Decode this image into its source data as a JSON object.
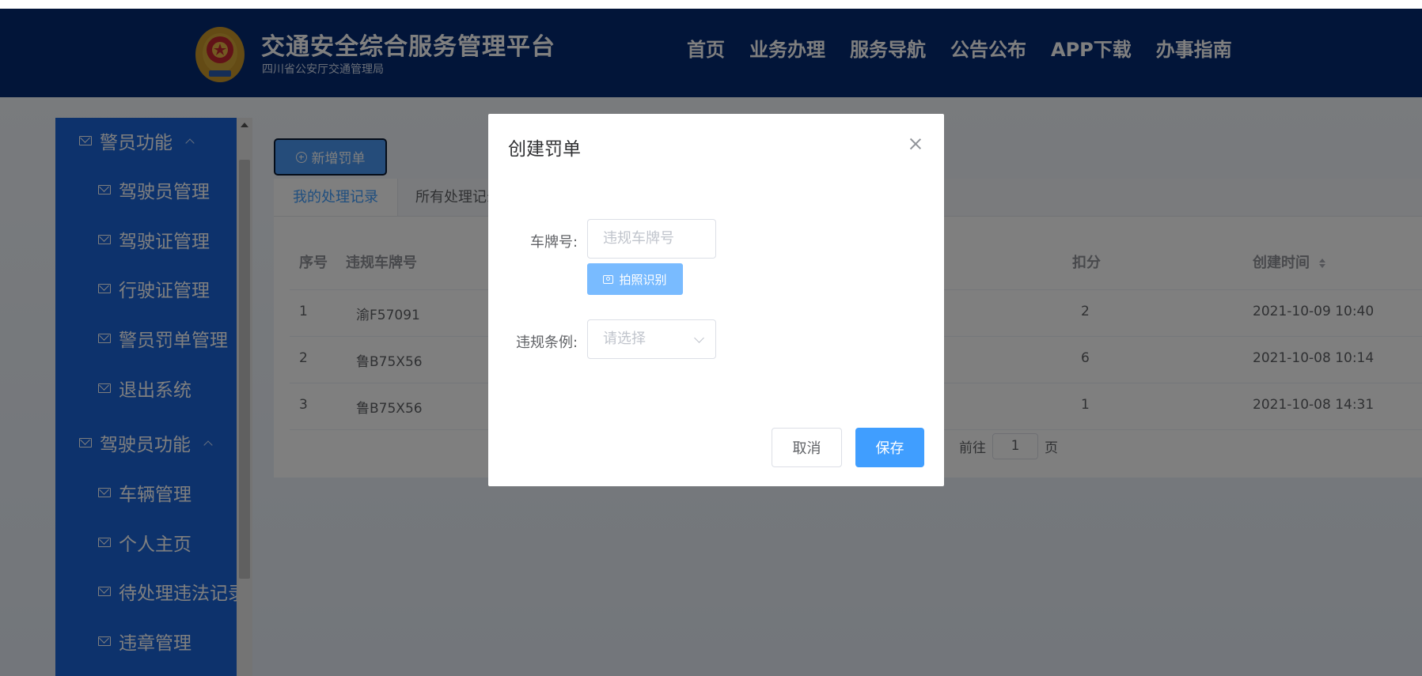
{
  "header": {
    "title": "交通安全综合服务管理平台",
    "subtitle": "四川省公安厅交通管理局",
    "nav": [
      "首页",
      "业务办理",
      "服务导航",
      "公告公布",
      "APP下载",
      "办事指南"
    ]
  },
  "sidebar": {
    "groups": [
      {
        "label": "警员功能",
        "items": [
          "驾驶员管理",
          "驾驶证管理",
          "行驶证管理",
          "警员罚单管理",
          "退出系统"
        ]
      },
      {
        "label": "驾驶员功能",
        "items": [
          "车辆管理",
          "个人主页",
          "待处理违法记录",
          "违章管理"
        ]
      }
    ]
  },
  "main": {
    "add_button": "新增罚单",
    "tabs": [
      "我的处理记录",
      "所有处理记录"
    ],
    "columns": {
      "index": "序号",
      "plate": "违规车牌号",
      "points": "扣分",
      "created": "创建时间"
    },
    "rows": [
      {
        "index": "1",
        "plate": "渝F57091",
        "points": "2",
        "created": "2021-10-09 10:40"
      },
      {
        "index": "2",
        "plate": "鲁B75X56",
        "points": "6",
        "created": "2021-10-08 10:14"
      },
      {
        "index": "3",
        "plate": "鲁B75X56",
        "points": "1",
        "created": "2021-10-08 14:31"
      }
    ],
    "pager": {
      "prefix": "前往",
      "page": "1",
      "suffix": "页"
    }
  },
  "dialog": {
    "title": "创建罚单",
    "plate_label": "车牌号:",
    "plate_placeholder": "违规车牌号",
    "ocr_button": "拍照识别",
    "rule_label": "违规条例:",
    "rule_placeholder": "请选择",
    "cancel": "取消",
    "save": "保存"
  },
  "colors": {
    "header": "#052a72",
    "sidebar": "#1a64d8",
    "primary": "#409eff"
  }
}
